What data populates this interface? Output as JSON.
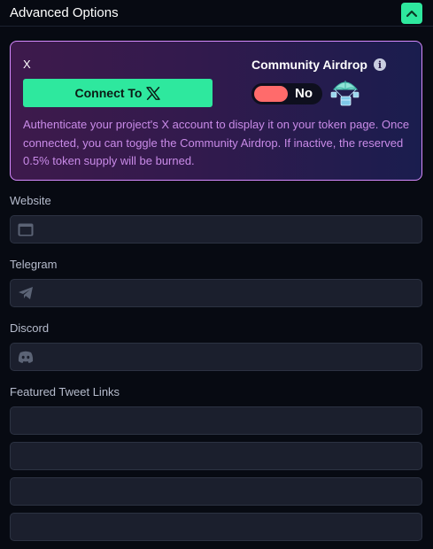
{
  "header": {
    "title": "Advanced Options"
  },
  "social_card": {
    "x_label": "X",
    "connect_button_label": "Connect To",
    "airdrop_label": "Community Airdrop",
    "toggle_value": "No",
    "description": "Authenticate your project's X account to display it on your token page. Once connected, you can toggle the Community Airdrop. If inactive, the reserved 0.5% token supply will be burned."
  },
  "fields": {
    "website": {
      "label": "Website",
      "value": "",
      "icon": "browser-window-icon"
    },
    "telegram": {
      "label": "Telegram",
      "value": "",
      "icon": "telegram-icon"
    },
    "discord": {
      "label": "Discord",
      "value": "",
      "icon": "discord-icon"
    }
  },
  "featured_tweets": {
    "label": "Featured Tweet Links",
    "links": [
      "",
      "",
      "",
      ""
    ]
  },
  "colors": {
    "accent": "#2ee89e",
    "toggle_off": "#ff6b6b",
    "card_border": "#d68bff",
    "description_text": "#c98be8"
  }
}
